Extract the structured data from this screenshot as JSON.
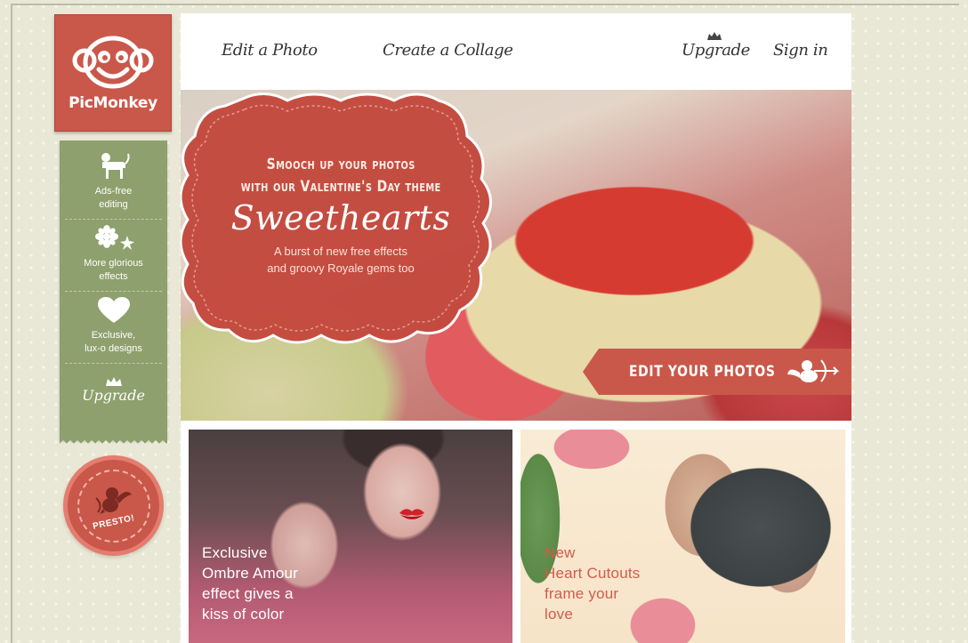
{
  "brand": {
    "logo_text": "PicMonkey",
    "accent": "#c9584a",
    "sidebar_green": "#8ea06d"
  },
  "nav": {
    "edit_photo": "Edit a Photo",
    "create_collage": "Create a Collage",
    "upgrade": "Upgrade",
    "sign_in": "Sign in"
  },
  "sidebar": {
    "perks": [
      {
        "icon": "monkey-icon",
        "label": "Ads-free\nediting"
      },
      {
        "icon": "sparkle-flowers-icon",
        "label": "More glorious\neffects"
      },
      {
        "icon": "heart-icon",
        "label": "Exclusive,\nlux-o designs"
      }
    ],
    "upgrade": "Upgrade",
    "presto_badge": "PRESTO!"
  },
  "hero": {
    "headline": "Smooch up your photos\nwith our Valentine's Day theme",
    "script_title": "Sweethearts",
    "subtitle": "A burst of new free effects\nand groovy Royale gems too",
    "cta": "EDIT YOUR PHOTOS"
  },
  "tiles": [
    {
      "caption": "Exclusive\nOmbre Amour\neffect gives a\nkiss of color"
    },
    {
      "caption": "New\nHeart Cutouts\nframe your\nlove"
    }
  ]
}
